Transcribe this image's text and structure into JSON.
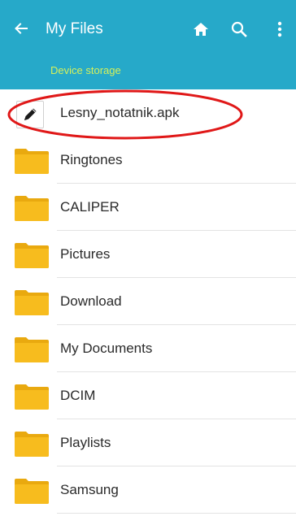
{
  "appbar": {
    "title": "My Files",
    "breadcrumb": "Device storage",
    "background_color": "#26a9c9",
    "breadcrumb_color": "#d6f05a"
  },
  "icons": {
    "back": "arrow-left-icon",
    "home": "home-icon",
    "search": "search-icon",
    "more": "more-vertical-icon",
    "file": "pencil-icon",
    "folder": "folder-icon"
  },
  "files": [
    {
      "name": "Lesny_notatnik.apk",
      "type": "file",
      "highlighted": true
    },
    {
      "name": "Ringtones",
      "type": "folder"
    },
    {
      "name": "CALIPER",
      "type": "folder"
    },
    {
      "name": "Pictures",
      "type": "folder"
    },
    {
      "name": "Download",
      "type": "folder"
    },
    {
      "name": "My Documents",
      "type": "folder"
    },
    {
      "name": "DCIM",
      "type": "folder"
    },
    {
      "name": "Playlists",
      "type": "folder"
    },
    {
      "name": "Samsung",
      "type": "folder"
    }
  ],
  "colors": {
    "folder": "#f7bc1e",
    "folder_dark": "#e9a90f",
    "annotation": "#e01818"
  }
}
